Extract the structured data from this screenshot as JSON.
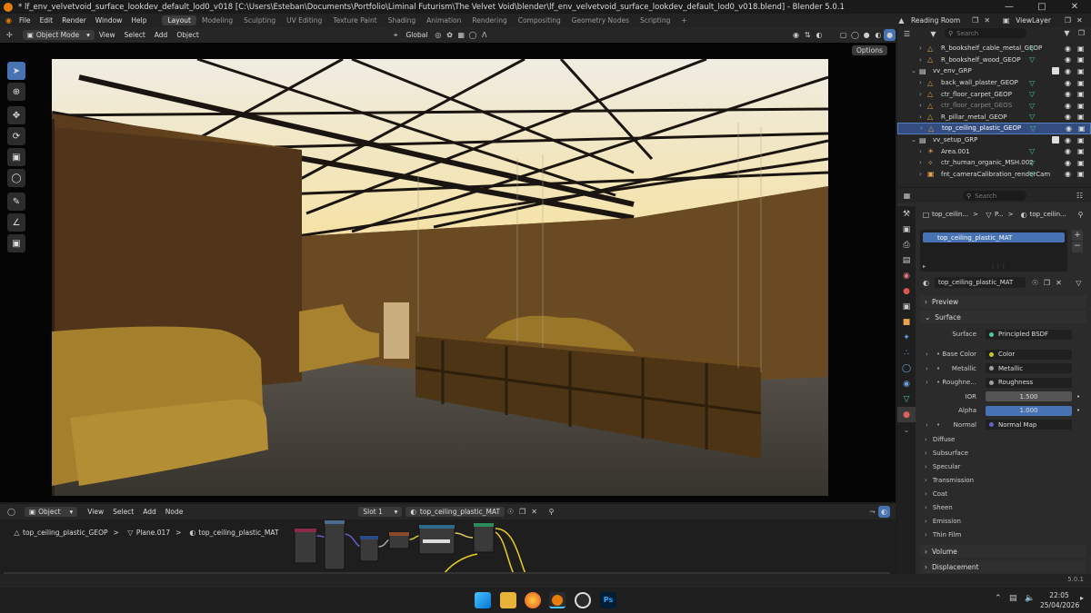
{
  "window": {
    "title": "* lf_env_velvetvoid_surface_lookdev_default_lod0_v018 [C:\\Users\\Esteban\\Documents\\Portfolio\\Liminal Futurism\\The Velvet Void\\blender\\lf_env_velvetvoid_surface_lookdev_default_lod0_v018.blend] - Blender 5.0.1"
  },
  "menu": [
    "File",
    "Edit",
    "Render",
    "Window",
    "Help"
  ],
  "workspaces": [
    "Layout",
    "Modeling",
    "Sculpting",
    "UV Editing",
    "Texture Paint",
    "Shading",
    "Animation",
    "Rendering",
    "Compositing",
    "Geometry Nodes",
    "Scripting"
  ],
  "active_workspace": "Layout",
  "scene": {
    "name": "Reading Room",
    "view_layer": "ViewLayer"
  },
  "viewport": {
    "mode": "Object Mode",
    "menus": [
      "View",
      "Select",
      "Add",
      "Object"
    ],
    "orientation": "Global",
    "options_label": "Options"
  },
  "outliner": {
    "search_placeholder": "Search",
    "items": [
      {
        "name": "R_bookshelf_cable_metal_GEOP",
        "indent": 2,
        "type": "mesh"
      },
      {
        "name": "R_bookshelf_wood_GEOP",
        "indent": 2,
        "type": "mesh"
      },
      {
        "name": "vv_env_GRP",
        "indent": 1,
        "type": "collection"
      },
      {
        "name": "back_wall_plaster_GEOP",
        "indent": 2,
        "type": "mesh"
      },
      {
        "name": "ctr_floor_carpet_GEOP",
        "indent": 2,
        "type": "mesh"
      },
      {
        "name": "ctr_floor_carpet_GEOS",
        "indent": 2,
        "type": "mesh",
        "dim": true
      },
      {
        "name": "R_pillar_metal_GEOP",
        "indent": 2,
        "type": "mesh"
      },
      {
        "name": "top_ceiling_plastic_GEOP",
        "indent": 2,
        "type": "mesh",
        "selected": true
      },
      {
        "name": "vv_setup_GRP",
        "indent": 1,
        "type": "collection"
      },
      {
        "name": "Area.001",
        "indent": 2,
        "type": "light"
      },
      {
        "name": "ctr_human_organic_MSH.002",
        "indent": 2,
        "type": "armature"
      },
      {
        "name": "fnt_cameraCalibration_renderCam0",
        "indent": 2,
        "type": "camera"
      }
    ]
  },
  "properties": {
    "search_placeholder": "Search",
    "breadcrumb": [
      "top_ceilin...",
      "P...",
      "top_ceilin..."
    ],
    "slot": "top_ceiling_plastic_MAT",
    "material": "top_ceiling_plastic_MAT",
    "sections_top": [
      "Preview",
      "Surface"
    ],
    "surface": "Principled BSDF",
    "rows": [
      {
        "label": "Base Color",
        "value": "Color",
        "dot": "#c7c729"
      },
      {
        "label": "Metallic",
        "value": "Metallic",
        "dot": "#a1a1a1"
      },
      {
        "label": "Roughne...",
        "value": "Roughness",
        "dot": "#a1a1a1"
      },
      {
        "label": "IOR",
        "value": "1.500",
        "dot": ""
      },
      {
        "label": "Alpha",
        "value": "1.000",
        "dot": "",
        "active": true
      },
      {
        "label": "Normal",
        "value": "Normal Map",
        "dot": "#6363c7"
      }
    ],
    "subsections": [
      "Diffuse",
      "Subsurface",
      "Specular",
      "Transmission",
      "Coat",
      "Sheen",
      "Emission",
      "Thin Film"
    ],
    "bottom": [
      "Volume",
      "Displacement"
    ]
  },
  "node_editor": {
    "type": "Object",
    "menus": [
      "View",
      "Select",
      "Add",
      "Node"
    ],
    "slot": "Slot 1",
    "material": "top_ceiling_plastic_MAT",
    "breadcrumb": [
      "top_ceiling_plastic_GEOP",
      "Plane.017",
      "top_ceiling_plastic_MAT"
    ]
  },
  "status": {
    "version": "5.0.1"
  },
  "taskbar": {
    "time": "22:05",
    "date": "25/04/2026"
  },
  "colors": {
    "accent": "#4772b3",
    "selected_row": "#334d80",
    "mesh_icon": "#e8a24e",
    "data_icon": "#4fc79a"
  }
}
